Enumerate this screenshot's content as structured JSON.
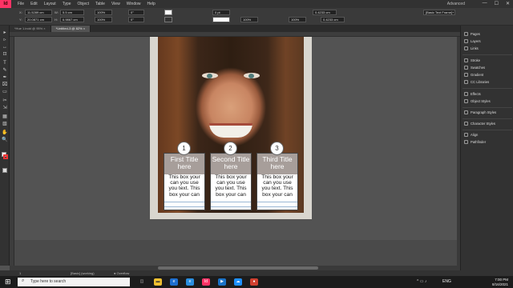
{
  "menubar": {
    "logo": "Id",
    "items": [
      "File",
      "Edit",
      "Layout",
      "Type",
      "Object",
      "Table",
      "View",
      "Window",
      "Help"
    ],
    "workspace": "Advanced",
    "win_min": "—",
    "win_max": "☐",
    "win_close": "✕"
  },
  "control": {
    "x_label": "X:",
    "x_value": "11.5289 cm",
    "y_label": "Y:",
    "y_value": "20.0871 cm",
    "w_label": "W:",
    "w_value": "5.5 cm",
    "h_label": "H:",
    "h_value": "6.9867 cm",
    "scale_x": "100%",
    "scale_y": "100%",
    "angle": "0°",
    "shear": "0°",
    "stroke_weight": "0 pt",
    "opacity": "100%",
    "dim_a": "0.4233 cm",
    "dim_b": "0.4233 cm",
    "frame_style": "[Basic Text Frame]+"
  },
  "tabs": [
    {
      "label": "*Hue 1.indd @ 95% ×",
      "active": false
    },
    {
      "label": "*Untitled-3 @ 82% ×",
      "active": true
    }
  ],
  "tools": [
    "▸",
    "▹",
    "↔",
    "⊡",
    "T",
    "✎",
    "✒",
    "⌧",
    "▭",
    "✂",
    "⇲",
    "▦",
    "▧",
    "✋",
    "🔍"
  ],
  "cards": [
    {
      "number": "1",
      "title": "First Title here",
      "body": "This box your can you use you text. This box your can you use you text."
    },
    {
      "number": "2",
      "title": "Second Title here",
      "body": "This box your can you use you text. This box your can you use you text."
    },
    {
      "number": "3",
      "title": "Third Title here",
      "body": "This box your can you use you text. This box your can you use you text."
    }
  ],
  "panels": {
    "items": [
      "Pages",
      "Layers",
      "Links",
      "Stroke",
      "Swatches",
      "Gradient",
      "CC Libraries",
      "Effects",
      "Object Styles",
      "Paragraph Styles",
      "Character Styles",
      "Align",
      "Pathfinder"
    ]
  },
  "status": {
    "page": "1",
    "style": "[Basic] (working)",
    "preflight": "● Overflow"
  },
  "taskbar": {
    "search_placeholder": "Type here to search",
    "lang": "ENG",
    "time": "7:00 PM",
    "date": "8/16/2021"
  },
  "colors": {
    "accent": "#ff3366",
    "chrome_dark": "#323232",
    "pasteboard": "#535353"
  }
}
